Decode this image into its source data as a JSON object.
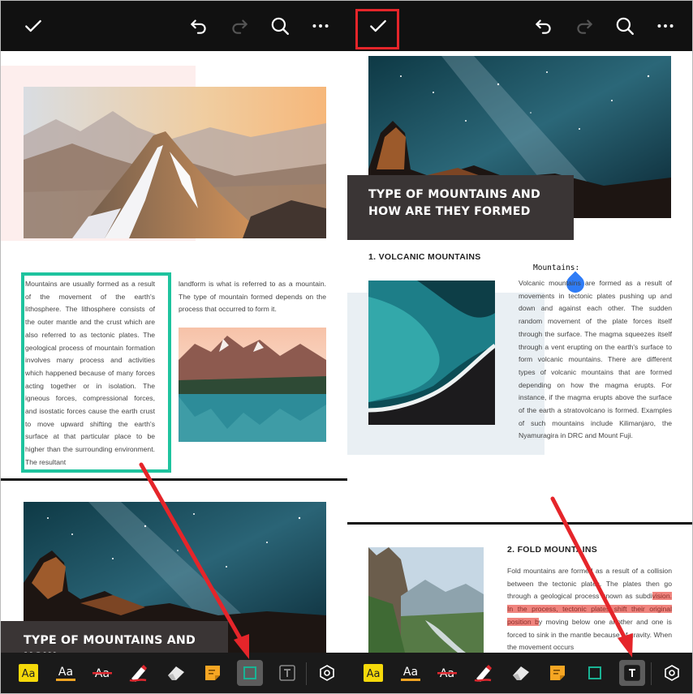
{
  "toolbar": {
    "confirm_icon": "check-icon",
    "undo_icon": "undo-icon",
    "redo_icon": "redo-icon",
    "search_icon": "search-icon",
    "more_icon": "more-icon"
  },
  "colors": {
    "selection_box": "#1ec39e",
    "highlight_box": "#e5252a",
    "arrow": "#e5252a",
    "text_highlight": "#f0847e",
    "rectangle_tool": "#19b394",
    "drag_handle": "#2f7cf6",
    "toolbar_bg": "#111111"
  },
  "left_page": {
    "body_col1": "Mountains are usually formed as a result of the movement of the earth's lithosphere. The lithosphere consists of the outer mantle and the crust which are also referred to as tectonic plates. The geological process of mountain formation involves many process and activities which happened because of many forces acting together or in isolation. The igneous forces, compressional forces, and isostatic forces cause the earth crust to move upward shifting the earth's surface at that particular place to be higher than the surrounding environment. The resultant",
    "body_col2": "landform is what is referred to as a mountain. The type of mountain formed depends on the process that occurred to form it.",
    "heading": "TYPE OF MOUNTAINS AND HOW"
  },
  "right_page": {
    "heading": "TYPE OF MOUNTAINS AND HOW ARE THEY FORMED",
    "section1_title": "1. VOLCANIC MOUNTAINS",
    "typed_text": "Mountains:",
    "volcanic_text": "Volcanic mountains are formed as a result of movements in tectonic plates pushing up and down and against each other. The sudden random movement of the plate forces itself through the surface. The magma squeezes itself through a vent erupting on the earth's surface to form volcanic mountains. There are different types of volcanic mountains that are formed depending on how the magma erupts. For instance, if the magma erupts above the surface of the earth a stratovolcano is formed. Examples of such mountains include Kilimanjaro, the Nyamuragira in DRC and Mount Fuji.",
    "section2_title": "2. FOLD MOUNTAINS",
    "fold_before": "Fold mountains are formed as a result of a collision between the tectonic plates. The plates then go through a geological process known as subdi",
    "fold_highlight": "vision. In the process, tectonic plates shift their original position b",
    "fold_after": "y moving below one another and one is forced to sink in the mantle because of gravity. When the movement occurs"
  },
  "tools": {
    "left": [
      "highlight-text-icon",
      "underline-text-icon",
      "strikethrough-text-icon",
      "pen-icon",
      "eraser-icon",
      "sticky-note-icon",
      "rectangle-icon",
      "text-box-icon",
      "settings-icon"
    ],
    "right": [
      "highlight-text-icon",
      "underline-text-icon",
      "strikethrough-text-icon",
      "pen-icon",
      "eraser-icon",
      "sticky-note-icon",
      "rectangle-icon",
      "text-box-icon",
      "settings-icon"
    ],
    "left_active": "rectangle-icon",
    "right_active": "text-box-icon"
  }
}
